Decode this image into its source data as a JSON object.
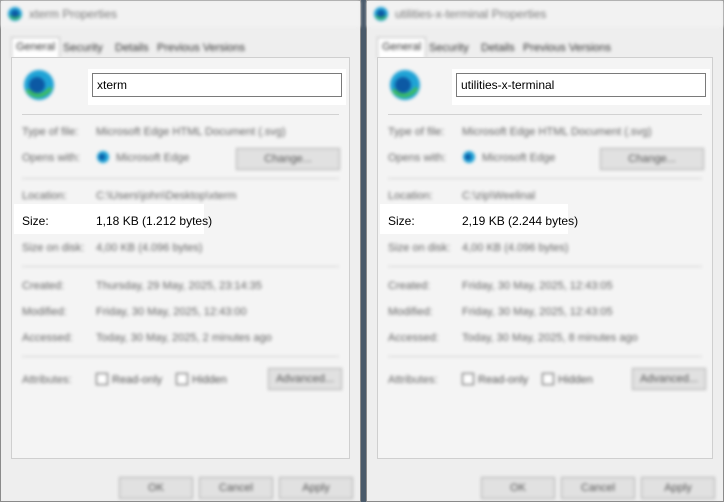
{
  "left": {
    "title": "xterm Properties",
    "tabs": [
      "General",
      "Security",
      "Details",
      "Previous Versions"
    ],
    "file_name": "xterm",
    "type_label": "Type of file:",
    "type_value": "Microsoft Edge HTML Document (.svg)",
    "opens_label": "Opens with:",
    "opens_value": "Microsoft Edge",
    "change_button": "Change...",
    "location_label": "Location:",
    "location_value": "C:\\Users\\john\\Desktop\\xterm",
    "size_label": "Size:",
    "size_value": "1,18 KB (1.212 bytes)",
    "size_on_disk_label": "Size on disk:",
    "size_on_disk_value": "4,00 KB (4.096 bytes)",
    "created_label": "Created:",
    "created_value": "Thursday, 29 May, 2025, 23:14:35",
    "modified_label": "Modified:",
    "modified_value": "Friday, 30 May, 2025, 12:43:00",
    "accessed_label": "Accessed:",
    "accessed_value": "Today, 30 May, 2025, 2 minutes ago",
    "attributes_label": "Attributes:",
    "readonly_label": "Read-only",
    "hidden_label": "Hidden",
    "advanced_button": "Advanced...",
    "ok_button": "OK",
    "cancel_button": "Cancel",
    "apply_button": "Apply"
  },
  "right": {
    "title": "utilities-x-terminal Properties",
    "tabs": [
      "General",
      "Security",
      "Details",
      "Previous Versions"
    ],
    "file_name": "utilities-x-terminal",
    "type_label": "Type of file:",
    "type_value": "Microsoft Edge HTML Document (.svg)",
    "opens_label": "Opens with:",
    "opens_value": "Microsoft Edge",
    "change_button": "Change...",
    "location_label": "Location:",
    "location_value": "C:\\zip\\Weelinal",
    "size_label": "Size:",
    "size_value": "2,19 KB (2.244 bytes)",
    "size_on_disk_label": "Size on disk:",
    "size_on_disk_value": "4,00 KB (4.096 bytes)",
    "created_label": "Created:",
    "created_value": "Friday, 30 May, 2025, 12:43:05",
    "modified_label": "Modified:",
    "modified_value": "Friday, 30 May, 2025, 12:43:05",
    "accessed_label": "Accessed:",
    "accessed_value": "Today, 30 May, 2025, 8 minutes ago",
    "attributes_label": "Attributes:",
    "readonly_label": "Read-only",
    "hidden_label": "Hidden",
    "advanced_button": "Advanced...",
    "ok_button": "OK",
    "cancel_button": "Cancel",
    "apply_button": "Apply"
  },
  "colors": {
    "edge_blue": "#0c59a4",
    "edge_green": "#3fbd5c",
    "edge_teal": "#1fa3d6",
    "background": "#3f4e5e"
  },
  "icons": {
    "app_icon": "edge-icon"
  }
}
